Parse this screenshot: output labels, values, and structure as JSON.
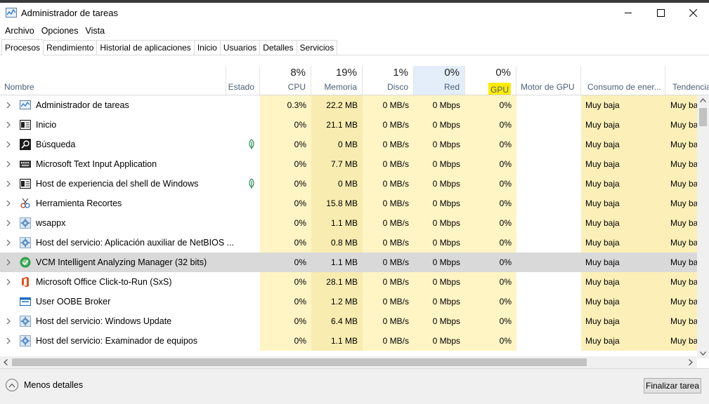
{
  "window": {
    "title": "Administrador de tareas"
  },
  "menu": [
    "Archivo",
    "Opciones",
    "Vista"
  ],
  "tabs": [
    "Procesos",
    "Rendimiento",
    "Historial de aplicaciones",
    "Inicio",
    "Usuarios",
    "Detalles",
    "Servicios"
  ],
  "active_tab": "Procesos",
  "columns": {
    "name": "Nombre",
    "status": "Estado",
    "cpu": {
      "pct": "8%",
      "label": "CPU"
    },
    "memory": {
      "pct": "19%",
      "label": "Memoria"
    },
    "disk": {
      "pct": "1%",
      "label": "Disco"
    },
    "network": {
      "pct": "0%",
      "label": "Red"
    },
    "gpu": {
      "pct": "0%",
      "label": "GPU"
    },
    "gpu_engine": "Motor de GPU",
    "power": "Consumo de ener...",
    "power_trend": "Tendencia"
  },
  "rows": [
    {
      "name": "Administrador de tareas",
      "icon": "task-manager-icon",
      "expandable": true,
      "leaf": false,
      "cpu": "0.3%",
      "mem": "22.2 MB",
      "disk": "0 MB/s",
      "net": "0 Mbps",
      "gpu": "0%",
      "power": "Muy baja",
      "trend": "Muy ba"
    },
    {
      "name": "Inicio",
      "icon": "window-icon",
      "expandable": true,
      "leaf": false,
      "cpu": "0%",
      "mem": "21.1 MB",
      "disk": "0 MB/s",
      "net": "0 Mbps",
      "gpu": "0%",
      "power": "Muy baja",
      "trend": "Muy ba"
    },
    {
      "name": "Búsqueda",
      "icon": "search-icon",
      "expandable": true,
      "leaf": true,
      "cpu": "0%",
      "mem": "0 MB",
      "disk": "0 MB/s",
      "net": "0 Mbps",
      "gpu": "0%",
      "power": "Muy baja",
      "trend": "Muy ba"
    },
    {
      "name": "Microsoft Text Input Application",
      "icon": "keyboard-icon",
      "expandable": true,
      "leaf": false,
      "cpu": "0%",
      "mem": "7.7 MB",
      "disk": "0 MB/s",
      "net": "0 Mbps",
      "gpu": "0%",
      "power": "Muy baja",
      "trend": "Muy ba"
    },
    {
      "name": "Host de experiencia del shell de Windows",
      "icon": "window-icon",
      "expandable": true,
      "leaf": true,
      "cpu": "0%",
      "mem": "0 MB",
      "disk": "0 MB/s",
      "net": "0 Mbps",
      "gpu": "0%",
      "power": "Muy baja",
      "trend": "Muy ba"
    },
    {
      "name": "Herramienta Recortes",
      "icon": "snipping-tool-icon",
      "expandable": true,
      "leaf": false,
      "cpu": "0%",
      "mem": "15.8 MB",
      "disk": "0 MB/s",
      "net": "0 Mbps",
      "gpu": "0%",
      "power": "Muy baja",
      "trend": "Muy ba"
    },
    {
      "name": "wsappx",
      "icon": "gear-icon",
      "expandable": true,
      "leaf": false,
      "cpu": "0%",
      "mem": "1.1 MB",
      "disk": "0 MB/s",
      "net": "0 Mbps",
      "gpu": "0%",
      "power": "Muy baja",
      "trend": "Muy ba"
    },
    {
      "name": "Host del servicio: Aplicación auxiliar de NetBIOS ...",
      "icon": "gear-icon",
      "expandable": true,
      "leaf": false,
      "cpu": "0%",
      "mem": "0.8 MB",
      "disk": "0 MB/s",
      "net": "0 Mbps",
      "gpu": "0%",
      "power": "Muy baja",
      "trend": "Muy ba"
    },
    {
      "name": "VCM Intelligent Analyzing Manager (32 bits)",
      "icon": "vcm-icon",
      "expandable": true,
      "leaf": false,
      "selected": true,
      "cpu": "0%",
      "mem": "1.1 MB",
      "disk": "0 MB/s",
      "net": "0 Mbps",
      "gpu": "0%",
      "power": "Muy baja",
      "trend": "Muy ba"
    },
    {
      "name": "Microsoft Office Click-to-Run (SxS)",
      "icon": "office-icon",
      "expandable": true,
      "leaf": false,
      "cpu": "0%",
      "mem": "28.1 MB",
      "disk": "0 MB/s",
      "net": "0 Mbps",
      "gpu": "0%",
      "power": "Muy baja",
      "trend": "Muy ba"
    },
    {
      "name": "User OOBE Broker",
      "icon": "window-blue-icon",
      "expandable": false,
      "leaf": false,
      "cpu": "0%",
      "mem": "1.2 MB",
      "disk": "0 MB/s",
      "net": "0 Mbps",
      "gpu": "0%",
      "power": "Muy baja",
      "trend": "Muy ba"
    },
    {
      "name": "Host del servicio: Windows Update",
      "icon": "gear-icon",
      "expandable": true,
      "leaf": false,
      "cpu": "0%",
      "mem": "6.4 MB",
      "disk": "0 MB/s",
      "net": "0 Mbps",
      "gpu": "0%",
      "power": "Muy baja",
      "trend": "Muy ba"
    },
    {
      "name": "Host del servicio: Examinador de equipos",
      "icon": "gear-icon",
      "expandable": true,
      "leaf": false,
      "cpu": "0%",
      "mem": "1.1 MB",
      "disk": "0 MB/s",
      "net": "0 Mbps",
      "gpu": "0%",
      "power": "Muy baja",
      "trend": "Muy ba"
    }
  ],
  "footer": {
    "less_details": "Menos detalles",
    "end_task": "Finalizar tarea"
  },
  "colors": {
    "heat_low": "#fff4c4",
    "heat_mem": "#f9ecb0",
    "gpu_highlight": "#ffeb00",
    "net_header": "#e3eefa",
    "selected_row": "#d9d9d9"
  }
}
